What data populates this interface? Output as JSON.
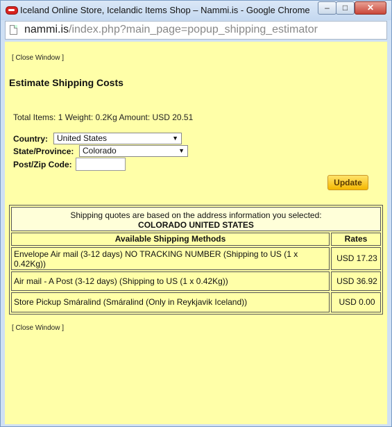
{
  "window": {
    "title": "Iceland Online Store, Icelandic Items Shop – Nammi.is - Google Chrome",
    "buttons": {
      "minimize": "–",
      "maximize": "□",
      "close": "✕"
    }
  },
  "address": {
    "domain": "nammi.is",
    "path": "/index.php?main_page=popup_shipping_estimator"
  },
  "page": {
    "close_window_top": "[ Close Window ]",
    "heading": "Estimate Shipping Costs",
    "totals": "Total Items: 1  Weight: 0.2Kg  Amount: USD 20.51",
    "country_label": "Country:",
    "country_value": "United States",
    "state_label": "State/Province:",
    "state_value": "Colorado",
    "zip_label": "Post/Zip Code:",
    "zip_value": "",
    "update_label": "Update",
    "notice": "Shipping quotes are based on the address information you selected:",
    "destination": "COLORADO UNITED STATES",
    "col_methods": "Available Shipping Methods",
    "col_rates": "Rates",
    "rows": [
      {
        "method": "Envelope Air mail (3-12 days) NO TRACKING NUMBER (Shipping to US (1 x 0.42Kg))",
        "rate": "USD 17.23"
      },
      {
        "method": "Air mail - A Post (3-12 days) (Shipping to US (1 x 0.42Kg))",
        "rate": "USD 36.92"
      },
      {
        "method": "Store Pickup Smáralind (Smáralind (Only in Reykjavik Iceland))",
        "rate": "USD 0.00"
      }
    ],
    "close_window_bottom": "[ Close Window ]"
  },
  "colors": {
    "page_bg": "#ffffa8",
    "notice_bg": "#ffffd9",
    "update_button": "#f4b700",
    "close_button": "#c9473a"
  },
  "icons": {
    "app": "chrome-app-icon",
    "page": "page-icon",
    "dropdown": "chevron-down-icon"
  }
}
